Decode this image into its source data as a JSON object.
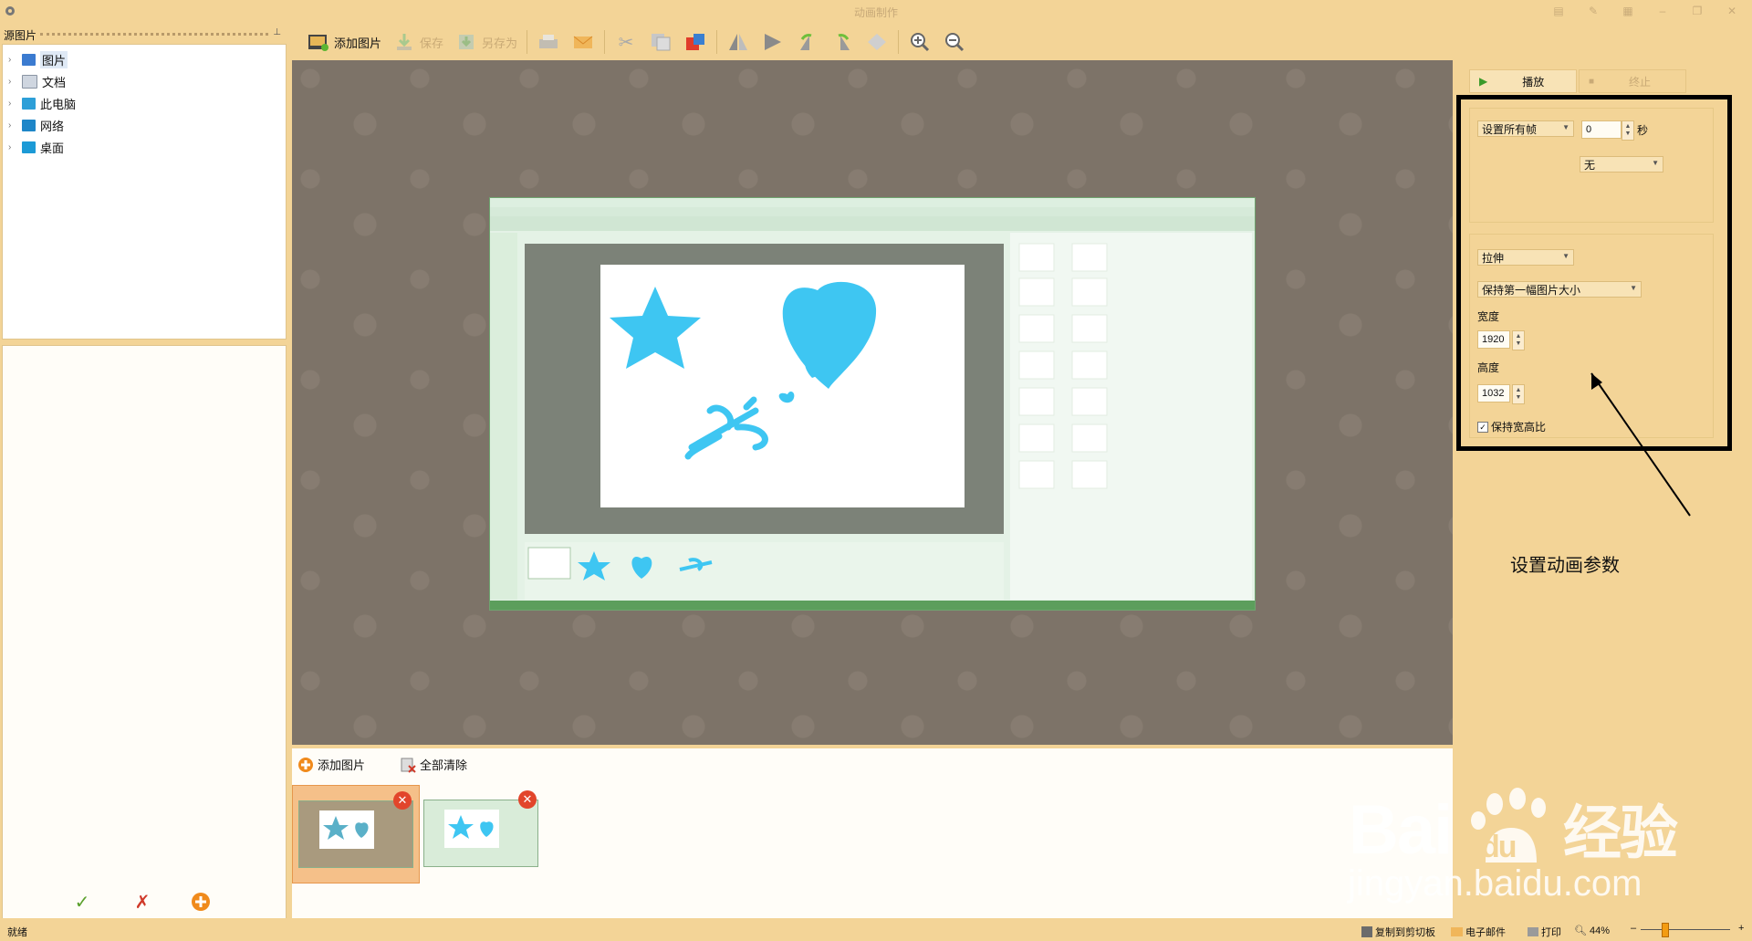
{
  "app": {
    "title": "动画制作"
  },
  "left_panel": {
    "header": "源图片",
    "tree": [
      "图片",
      "文档",
      "此电脑",
      "网络",
      "桌面"
    ]
  },
  "toolbar": {
    "add_image": "添加图片",
    "save": "保存",
    "save_as": "另存为"
  },
  "film_strip": {
    "add_image": "添加图片",
    "clear_all": "全部清除"
  },
  "right_panel": {
    "play": "播放",
    "stop": "终止",
    "frame_mode": "设置所有帧",
    "frame_value": "0",
    "seconds_unit": "秒",
    "effect": "无",
    "stretch_mode": "拉伸",
    "size_mode": "保持第一幅图片大小",
    "width_label": "宽度",
    "width_value": "1920",
    "height_label": "高度",
    "height_value": "1032",
    "keep_ratio_label": "保持宽高比",
    "keep_ratio_checked": true
  },
  "annotation": "设置动画参数",
  "watermark": {
    "logo": "Bai du 经验",
    "url": "jingyan.baidu.com"
  },
  "status_bar": {
    "ready": "就绪",
    "copy_clipboard": "复制到剪切板",
    "email": "电子邮件",
    "print": "打印",
    "zoom": "44%"
  },
  "colors": {
    "panel_bg": "#f3d497",
    "accent_blue": "#3ec6f2",
    "frame_green": "#6fa36f"
  }
}
